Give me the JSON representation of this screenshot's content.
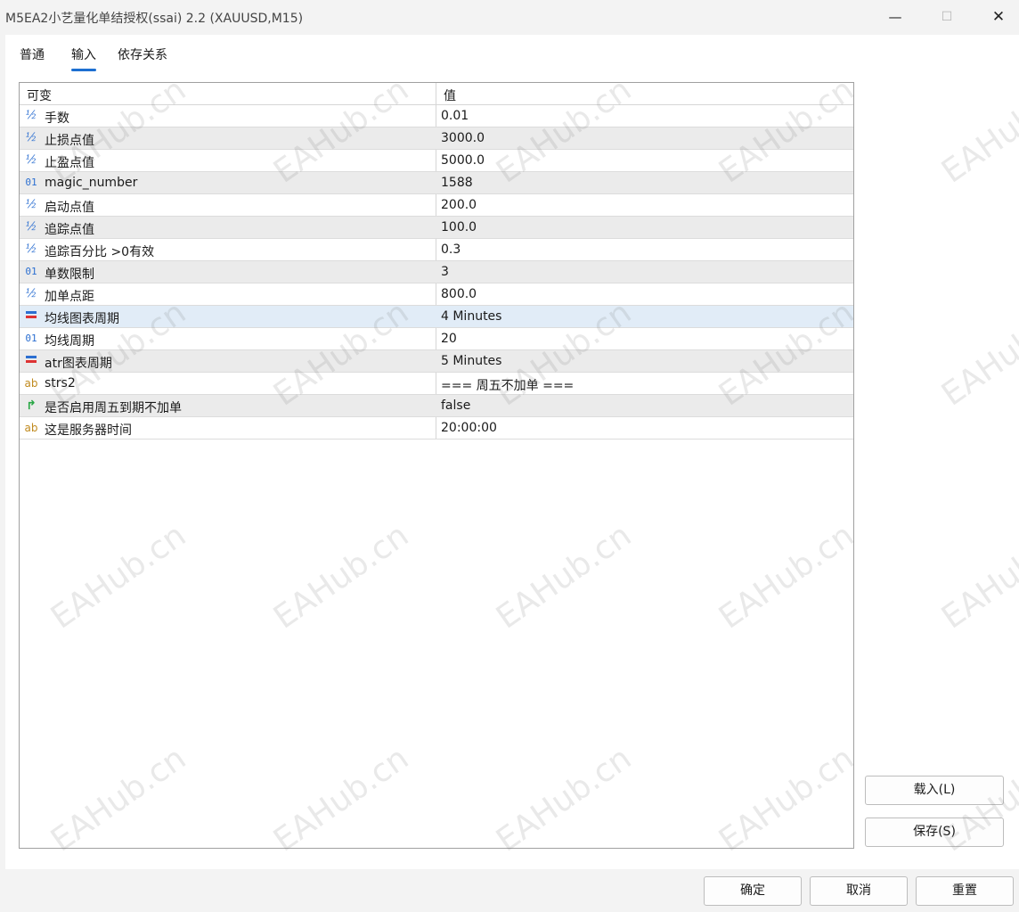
{
  "window": {
    "title": "M5EA2小艺量化单结授权(ssai) 2.2 (XAUUSD,M15)",
    "minimize_glyph": "—",
    "maximize_glyph": "☐",
    "close_glyph": "✕"
  },
  "tabs": [
    {
      "label": "普通",
      "active": false
    },
    {
      "label": "输入",
      "active": true
    },
    {
      "label": "依存关系",
      "active": false
    }
  ],
  "table": {
    "headers": {
      "name": "可变",
      "value": "值"
    },
    "rows": [
      {
        "icon": "double-icon",
        "glyph": "½",
        "name": "手数",
        "value": "0.01"
      },
      {
        "icon": "double-icon",
        "glyph": "½",
        "name": "止损点值",
        "value": "3000.0"
      },
      {
        "icon": "double-icon",
        "glyph": "½",
        "name": "止盈点值",
        "value": "5000.0"
      },
      {
        "icon": "integer-icon",
        "glyph": "01",
        "name": "magic_number",
        "value": "1588"
      },
      {
        "icon": "double-icon",
        "glyph": "½",
        "name": "启动点值",
        "value": "200.0"
      },
      {
        "icon": "double-icon",
        "glyph": "½",
        "name": "追踪点值",
        "value": "100.0"
      },
      {
        "icon": "double-icon",
        "glyph": "½",
        "name": "追踪百分比 >0有效",
        "value": "0.3"
      },
      {
        "icon": "integer-icon",
        "glyph": "01",
        "name": "单数限制",
        "value": "3"
      },
      {
        "icon": "double-icon",
        "glyph": "½",
        "name": "加单点距",
        "value": "800.0"
      },
      {
        "icon": "enum-icon",
        "glyph": "",
        "name": "均线图表周期",
        "value": "4 Minutes"
      },
      {
        "icon": "integer-icon",
        "glyph": "01",
        "name": "均线周期",
        "value": "20"
      },
      {
        "icon": "enum-icon",
        "glyph": "",
        "name": "atr图表周期",
        "value": "5 Minutes"
      },
      {
        "icon": "string-icon",
        "glyph": "ab",
        "name": "strs2",
        "value": "=== 周五不加单 ==="
      },
      {
        "icon": "bool-icon",
        "glyph": "↱",
        "name": "是否启用周五到期不加单",
        "value": "false"
      },
      {
        "icon": "string-icon",
        "glyph": "ab",
        "name": "这是服务器时间",
        "value": "20:00:00"
      }
    ]
  },
  "side_buttons": {
    "load": "载入(L)",
    "save": "保存(S)"
  },
  "footer_buttons": {
    "ok": "确定",
    "cancel": "取消",
    "reset": "重置"
  },
  "watermark": "EAHub.cn"
}
